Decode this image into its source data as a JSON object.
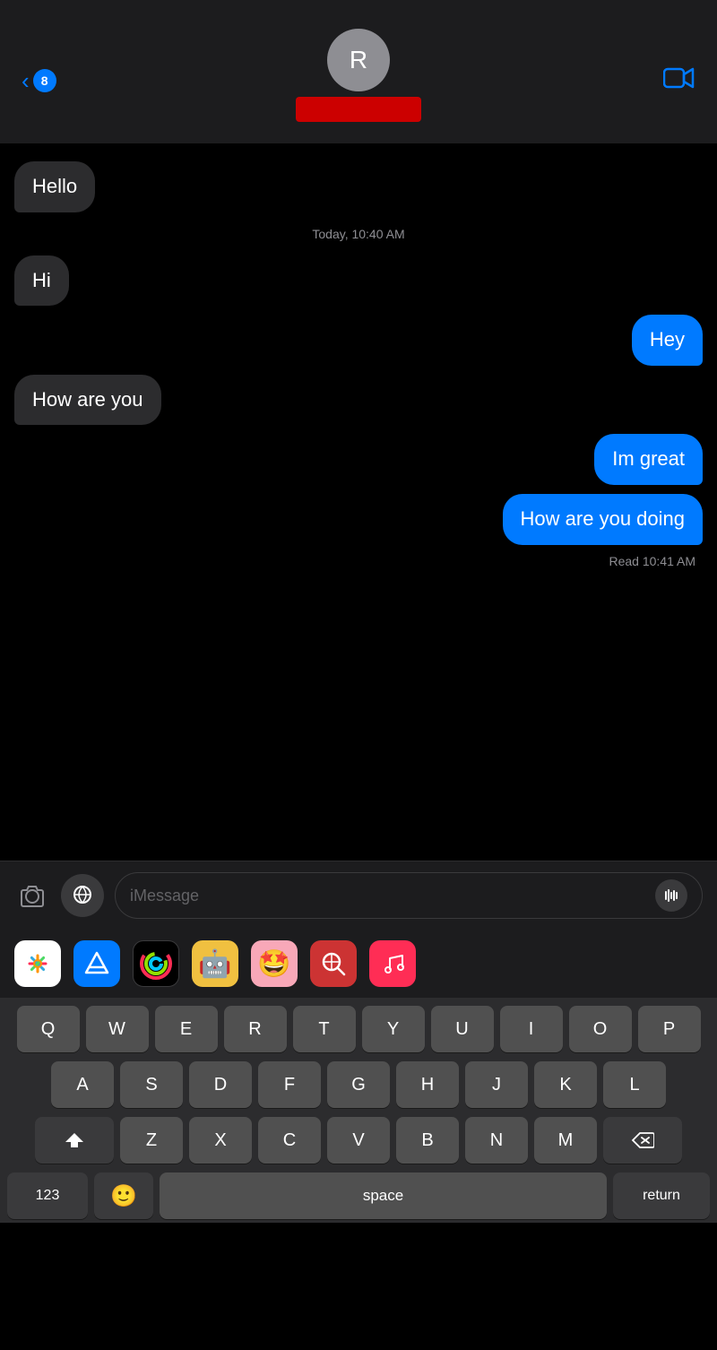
{
  "header": {
    "back_count": "8",
    "contact_initial": "R",
    "contact_name_hidden": true
  },
  "messages": [
    {
      "id": 1,
      "type": "received",
      "text": "Hello"
    },
    {
      "id": 2,
      "type": "timestamp",
      "text": "Today, 10:40 AM"
    },
    {
      "id": 3,
      "type": "received",
      "text": "Hi"
    },
    {
      "id": 4,
      "type": "sent",
      "text": "Hey"
    },
    {
      "id": 5,
      "type": "received",
      "text": "How are you"
    },
    {
      "id": 6,
      "type": "sent",
      "text": "Im great"
    },
    {
      "id": 7,
      "type": "sent",
      "text": "How are you doing"
    }
  ],
  "read_receipt": "Read 10:41 AM",
  "input": {
    "placeholder": "iMessage"
  },
  "keyboard": {
    "row1": [
      "Q",
      "W",
      "E",
      "R",
      "T",
      "Y",
      "U",
      "I",
      "O",
      "P"
    ],
    "row2": [
      "A",
      "S",
      "D",
      "F",
      "G",
      "H",
      "J",
      "K",
      "L"
    ],
    "row3": [
      "Z",
      "X",
      "C",
      "V",
      "B",
      "N",
      "M"
    ],
    "space_label": "space",
    "return_label": "return",
    "num_label": "123"
  }
}
